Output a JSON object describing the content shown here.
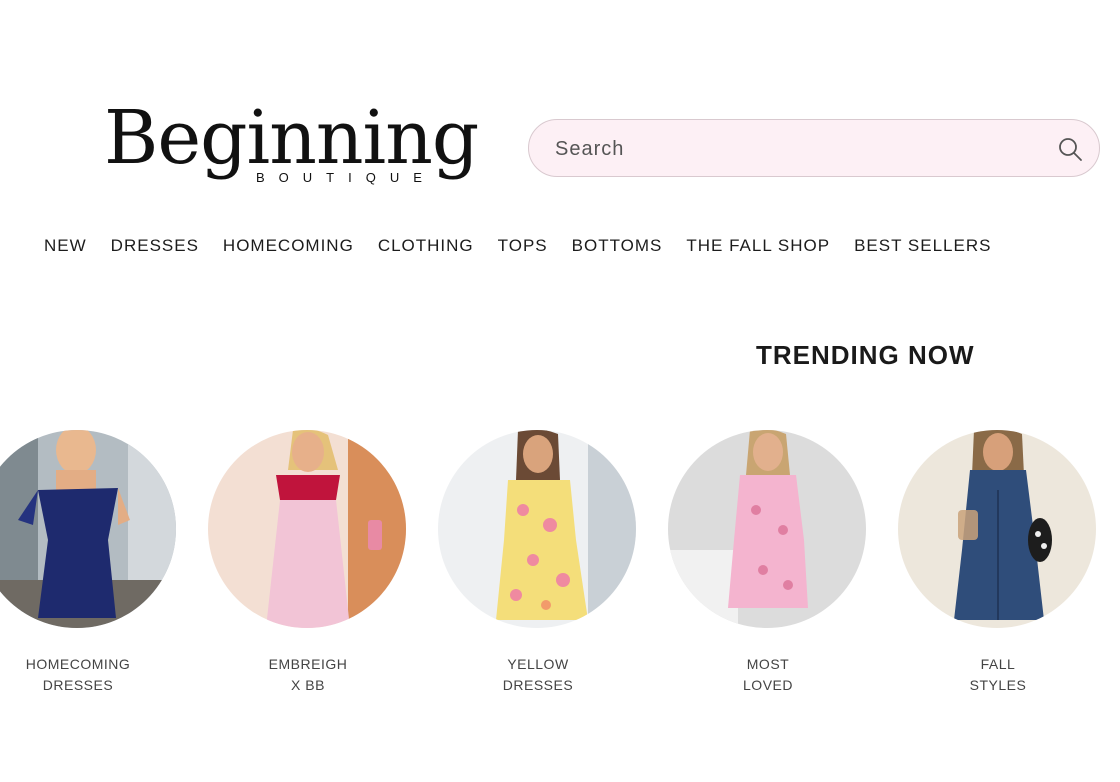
{
  "brand": {
    "name": "Beginning",
    "tagline": "BOUTIQUE"
  },
  "search": {
    "placeholder": "Search",
    "icon": "search-icon"
  },
  "nav": {
    "items": [
      {
        "label": "NEW"
      },
      {
        "label": "DRESSES"
      },
      {
        "label": "HOMECOMING"
      },
      {
        "label": "CLOTHING"
      },
      {
        "label": "TOPS"
      },
      {
        "label": "BOTTOMS"
      },
      {
        "label": "THE FALL SHOP"
      },
      {
        "label": "BEST SELLERS"
      }
    ]
  },
  "trending": {
    "title": "TRENDING NOW",
    "items": [
      {
        "line1": "HOMECOMING",
        "line2": "DRESSES",
        "dress_color": "#1e2a6e",
        "bg_color": "#9aa3a8"
      },
      {
        "line1": "EMBREIGH",
        "line2": "X BB",
        "dress_color": "#f2c4d6",
        "accent_color": "#c0143c",
        "bg_color": "#e7b58a"
      },
      {
        "line1": "YELLOW",
        "line2": "DRESSES",
        "dress_color": "#f4de7a",
        "accent_color": "#ef8aa0",
        "bg_color": "#e9ecef"
      },
      {
        "line1": "MOST",
        "line2": "LOVED",
        "dress_color": "#f4b4cf",
        "bg_color": "#d9d9d9"
      },
      {
        "line1": "FALL",
        "line2": "STYLES",
        "dress_color": "#2f4d7a",
        "bg_color": "#ece6da"
      }
    ]
  },
  "colors": {
    "search_bg": "#fdf0f5",
    "search_border": "#d9c9cf",
    "text": "#111111"
  }
}
